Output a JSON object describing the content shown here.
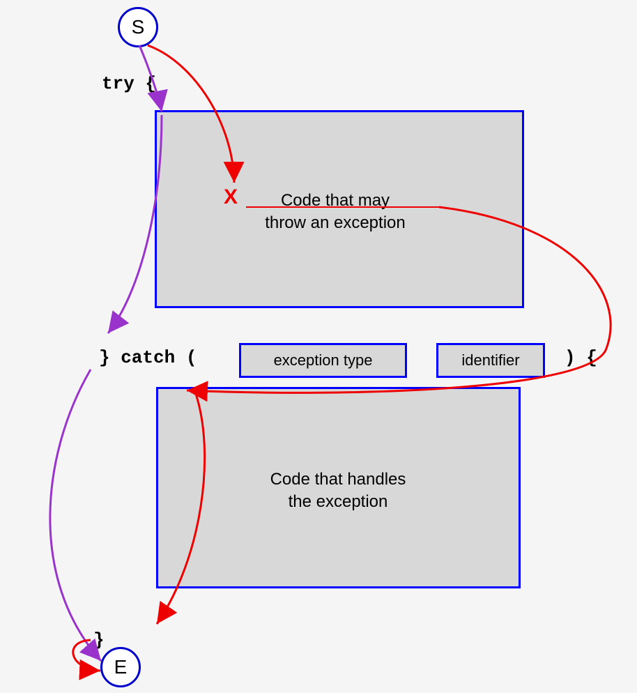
{
  "nodes": {
    "start": "S",
    "end": "E"
  },
  "labels": {
    "try": "try {",
    "catch": "} catch (",
    "paren_close": ") {",
    "close_brace": "}"
  },
  "boxes": {
    "try_text_l1": "Code that may",
    "try_text_l2": "throw an exception",
    "catch_text_l1": "Code that handles",
    "catch_text_l2": "the exception",
    "param1": "exception type",
    "param2": "identifier"
  },
  "x_mark": "X"
}
